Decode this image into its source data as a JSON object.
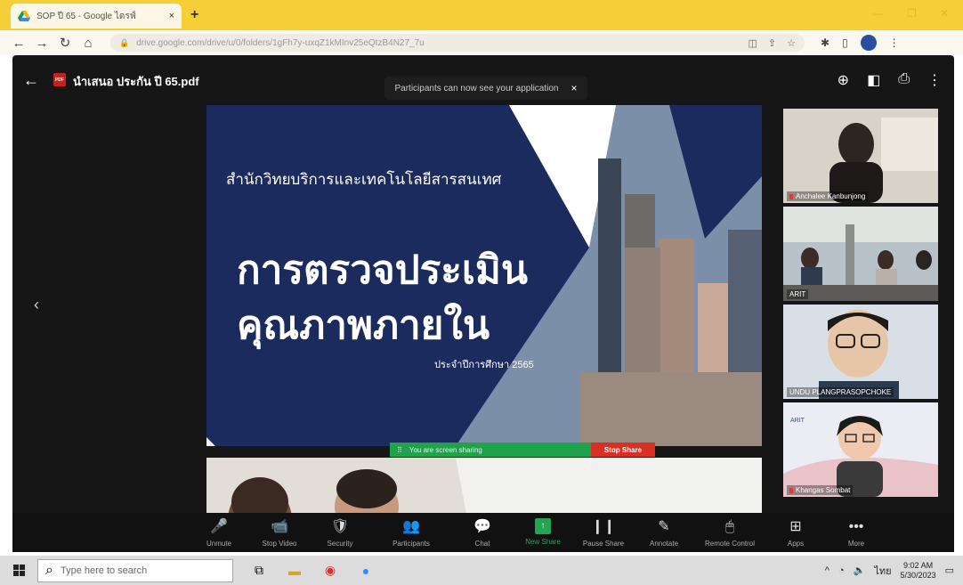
{
  "browser": {
    "tab_title": "SOP ปี 65 - Google ไดรฟ์",
    "tab_close": "×",
    "new_tab": "+",
    "url": "drive.google.com/drive/u/0/folders/1gFh7y-uxqZ1kMInv25eQtzB4N27_7u"
  },
  "viewer": {
    "file_name": "นำเสนอ ประกัน ปี 65.pdf",
    "pdf_badge": "PDF",
    "banner_text": "Participants can now see your application",
    "banner_close": "×"
  },
  "slide": {
    "org_name": "สำนักวิทยบริการและเทคโนโลยีสารสนเทศ",
    "title_line1": "การตรวจประเมิน",
    "title_line2": "คุณภาพภายใน",
    "year": "ประจำปีการศึกษา 2565"
  },
  "share": {
    "status": "You are screen sharing",
    "stop_label": "Stop Share"
  },
  "participants": [
    {
      "name": "Anchalee Kanbunjong"
    },
    {
      "name": "ARIT"
    },
    {
      "name": "UNDU PLANGPRASOPCHOKE"
    },
    {
      "name": "Khangas Sombat"
    }
  ],
  "zoom_toolbar": [
    {
      "icon": "🎤",
      "label": "Unmute"
    },
    {
      "icon": "📹",
      "label": "Stop Video"
    },
    {
      "icon": "🛡",
      "label": "Security"
    },
    {
      "icon": "👥",
      "label": "Participants"
    },
    {
      "icon": "💬",
      "label": "Chat"
    },
    {
      "icon": "↑",
      "label": "New Share"
    },
    {
      "icon": "❙❙",
      "label": "Pause Share"
    },
    {
      "icon": "✎",
      "label": "Annotate"
    },
    {
      "icon": "🖱",
      "label": "Remote Control"
    },
    {
      "icon": "⊞",
      "label": "Apps"
    },
    {
      "icon": "•••",
      "label": "More"
    }
  ],
  "taskbar": {
    "search_placeholder": "Type here to search",
    "time": "9:02 AM",
    "date": "5/30/2023",
    "lang": "ไทย"
  }
}
